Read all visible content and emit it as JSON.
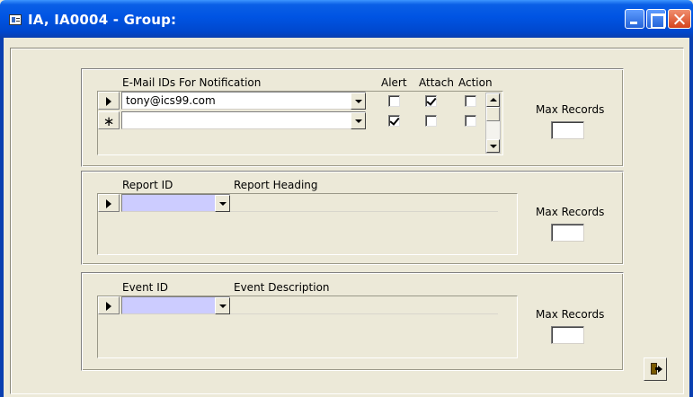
{
  "window": {
    "title": "IA, IA0004  -  Group:",
    "controls": [
      "minimize",
      "maximize",
      "close"
    ]
  },
  "email_section": {
    "header": "E-Mail IDs For Notification",
    "col_alert": "Alert",
    "col_attach": "Attach",
    "col_action": "Action",
    "rows": [
      {
        "value": "tony@ics99.com",
        "alert": false,
        "attach": true,
        "action": false
      },
      {
        "value": "",
        "alert": true,
        "attach": false,
        "action": false
      }
    ],
    "max_records_label": "Max Records",
    "max_records_value": ""
  },
  "report_section": {
    "col_id": "Report ID",
    "col_heading": "Report Heading",
    "id_value": "",
    "max_records_label": "Max Records",
    "max_records_value": ""
  },
  "event_section": {
    "col_id": "Event ID",
    "col_description": "Event Description",
    "id_value": "",
    "max_records_label": "Max Records",
    "max_records_value": ""
  },
  "icons": {
    "system": "form-icon",
    "exit": "exit-door-icon"
  }
}
